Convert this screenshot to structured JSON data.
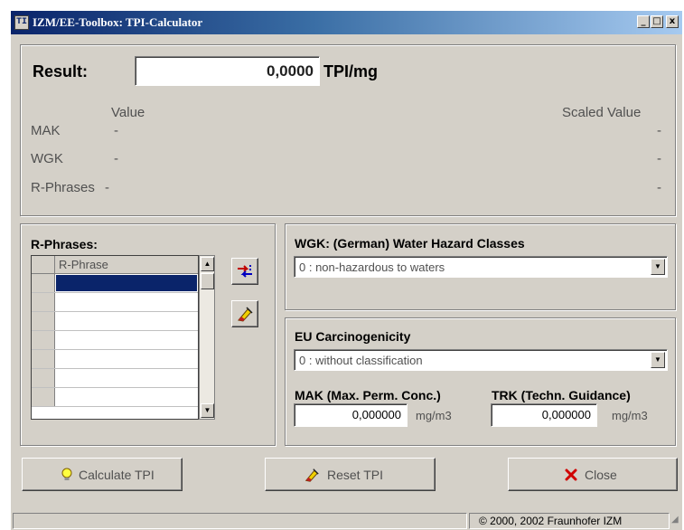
{
  "window": {
    "title": "IZM/EE-Toolbox: TPI-Calculator",
    "minimize": "_",
    "maximize": "□",
    "close": "x"
  },
  "result": {
    "label": "Result:",
    "value": "0,0000",
    "unit": "TPI/mg"
  },
  "summary": {
    "value_header": "Value",
    "scaled_header": "Scaled Value",
    "rows": [
      {
        "label": "MAK",
        "value": "-",
        "scaled": "-"
      },
      {
        "label": "WGK",
        "value": "-",
        "scaled": "-"
      },
      {
        "label": "R-Phrases",
        "value": "-",
        "scaled": "-"
      }
    ]
  },
  "rphrases": {
    "title": "R-Phrases:",
    "column": "R-Phrase"
  },
  "wgk": {
    "title": "WGK: (German) Water Hazard Classes",
    "selected": "0 : non-hazardous to waters"
  },
  "carc": {
    "title": "EU Carcinogenicity",
    "selected": "0 : without classification",
    "mak_label": "MAK (Max. Perm. Conc.)",
    "mak_value": "0,000000",
    "mak_unit": "mg/m3",
    "trk_label": "TRK (Techn. Guidance)",
    "trk_value": "0,000000",
    "trk_unit": "mg/m3"
  },
  "buttons": {
    "calculate": "Calculate TPI",
    "reset": "Reset TPI",
    "close": "Close"
  },
  "status": {
    "copyright": "© 2000, 2002 Fraunhofer IZM"
  },
  "icons": {
    "app": "izm-app-icon",
    "add": "add-phrase-icon",
    "clear": "eraser-icon",
    "bulb": "lightbulb-icon",
    "reset": "eraser-icon",
    "close": "red-x-icon"
  },
  "colors": {
    "title_gradient_start": "#0a246a",
    "selection": "#0a246a",
    "window_face": "#d4d0c8"
  }
}
